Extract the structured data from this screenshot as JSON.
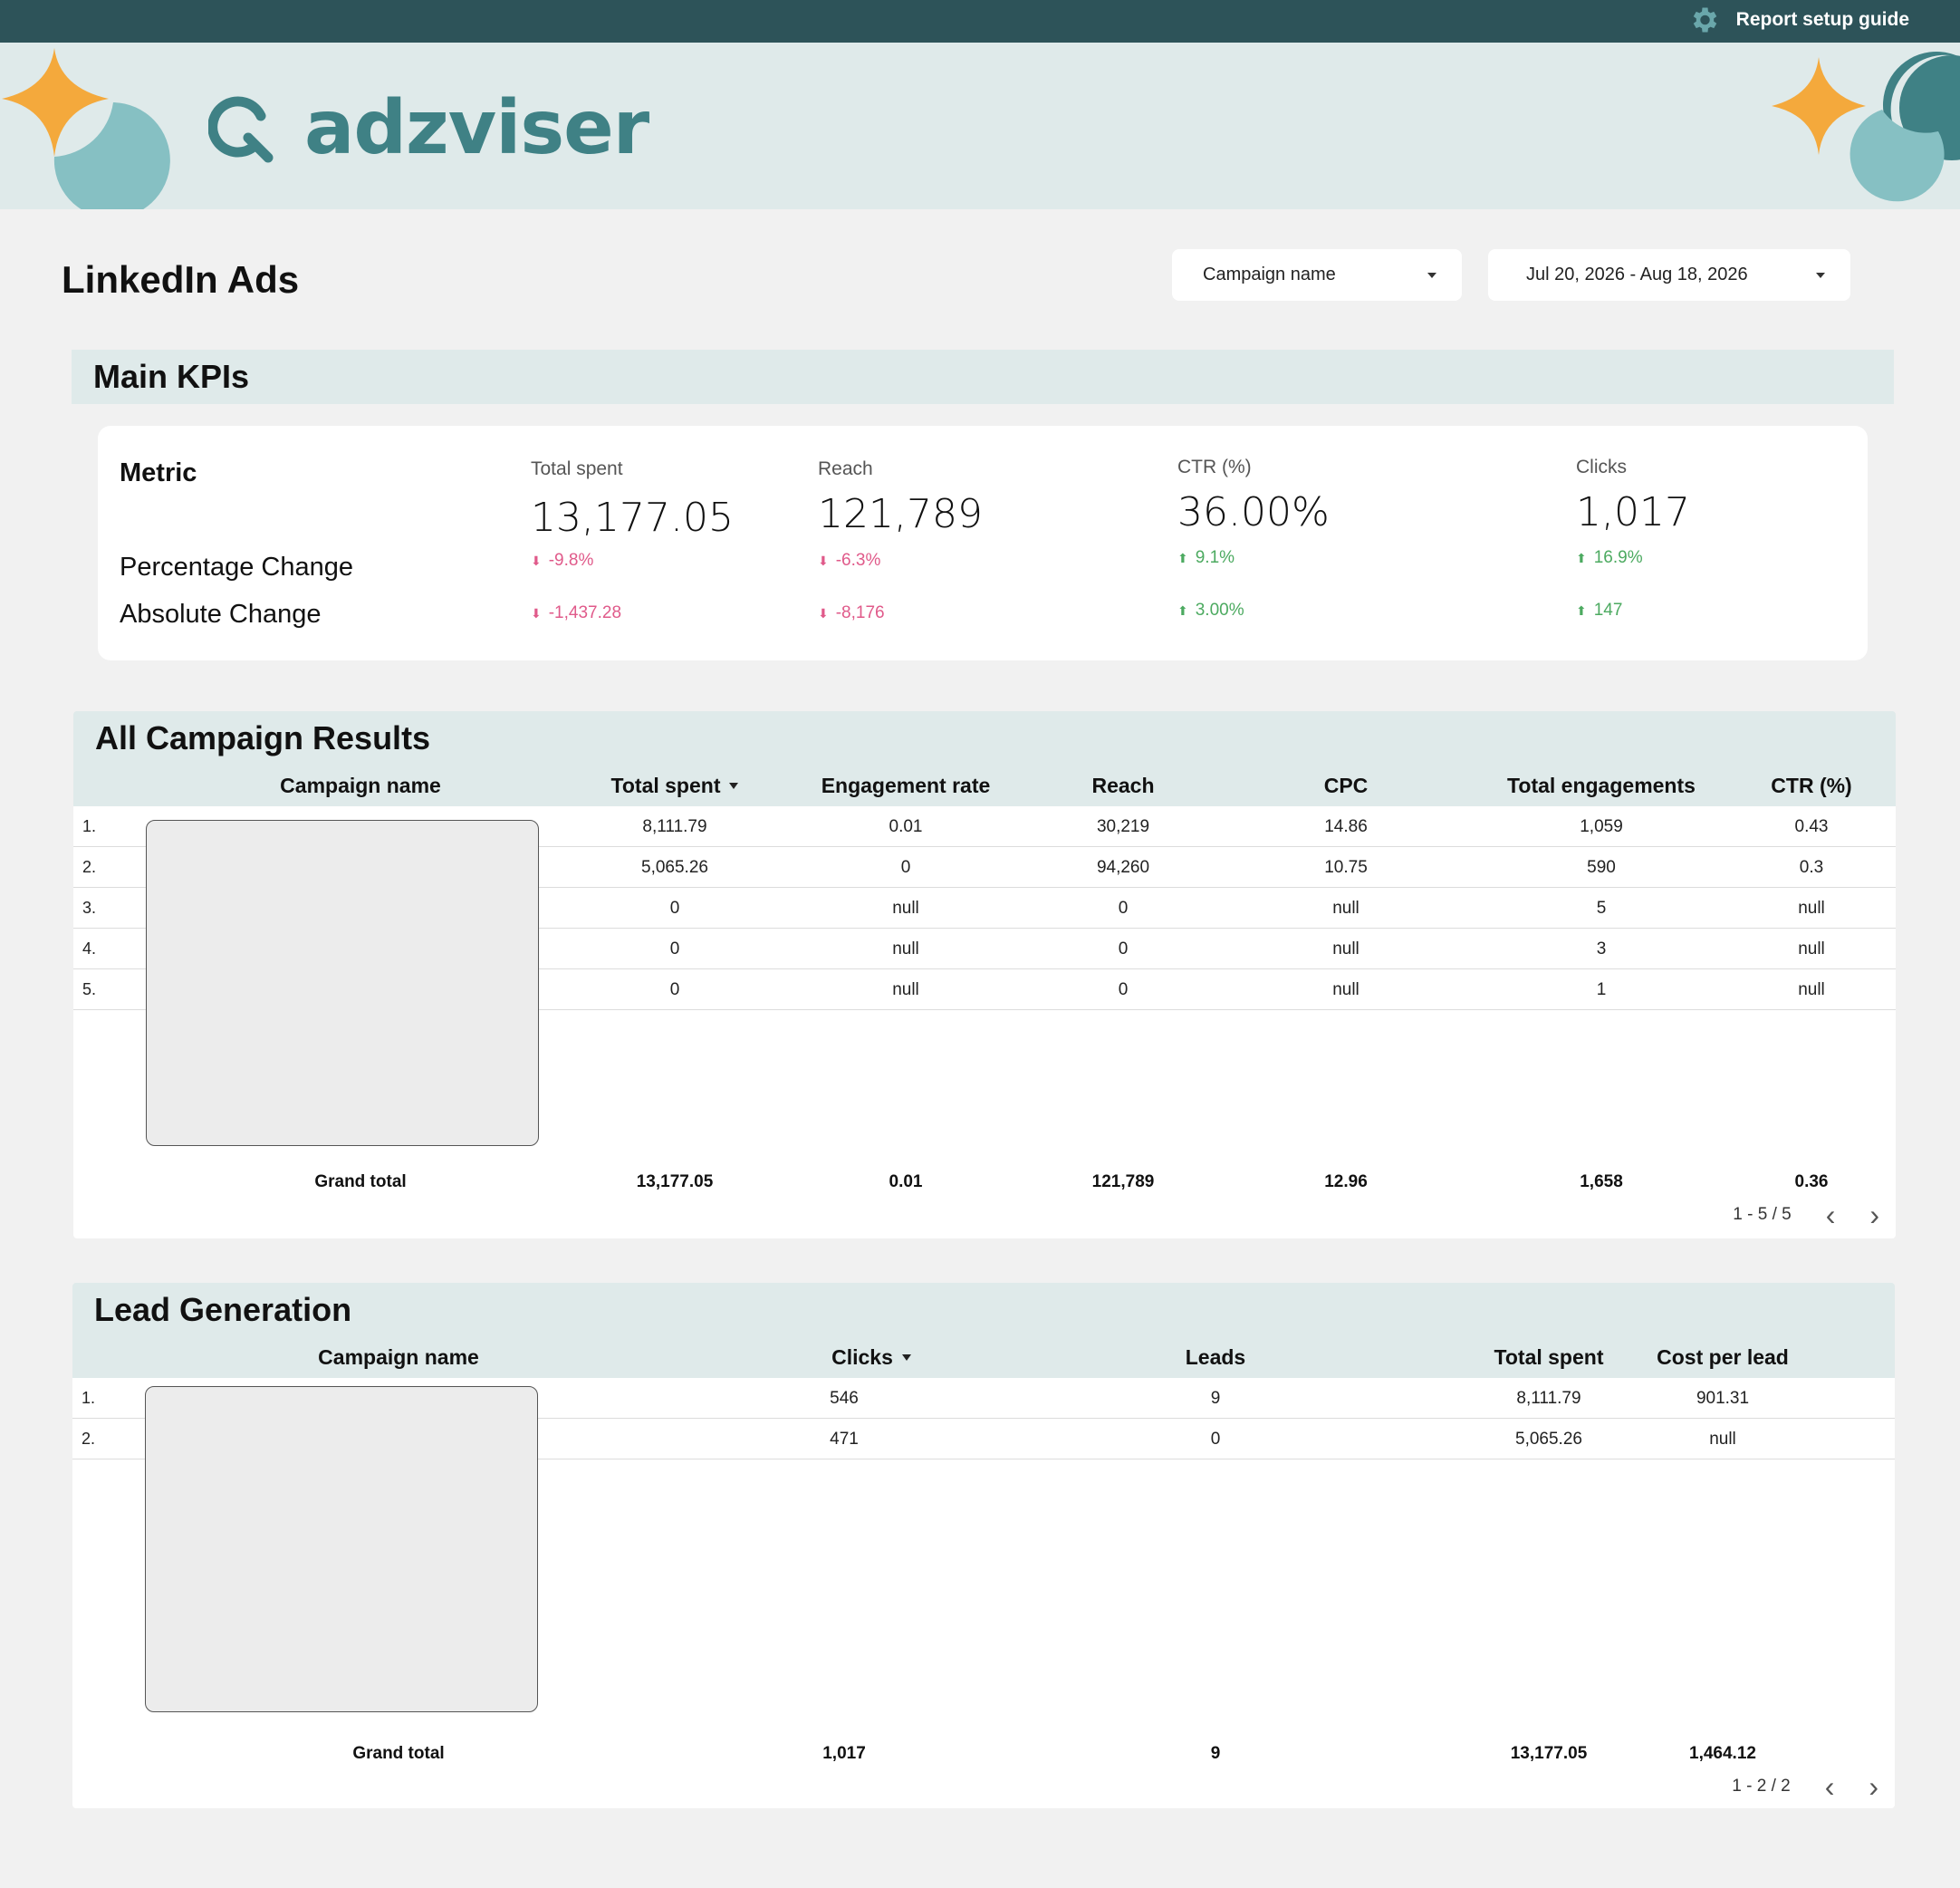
{
  "topbar": {
    "guide_label": "Report setup guide",
    "guide_icon": "gear-icon"
  },
  "brand": {
    "logo_text": "adzviser",
    "colors": {
      "dark": "#2d5359",
      "teal": "#3f8185",
      "light": "#dfeaea",
      "star": "#f4a93c"
    }
  },
  "page": {
    "title": "LinkedIn Ads"
  },
  "filters": {
    "campaign_label": "Campaign name",
    "date_label": "Jul 20, 2026 - Aug 18, 2026"
  },
  "kpi": {
    "section_title": "Main KPIs",
    "metric_label": "Metric",
    "pct_label": "Percentage Change",
    "abs_label": "Absolute Change",
    "metrics": [
      {
        "name": "Total spent",
        "value": "13,177.05",
        "pct": "-9.8%",
        "abs": "-1,437.28",
        "trend": "down"
      },
      {
        "name": "Reach",
        "value": "121,789",
        "pct": "-6.3%",
        "abs": "-8,176",
        "trend": "down"
      },
      {
        "name": "CTR (%)",
        "value": "36.00%",
        "pct": "9.1%",
        "abs": "3.00%",
        "trend": "up"
      },
      {
        "name": "Clicks",
        "value": "1,017",
        "pct": "16.9%",
        "abs": "147",
        "trend": "up"
      }
    ]
  },
  "campaigns": {
    "section_title": "All Campaign Results",
    "columns": [
      "Campaign name",
      "Total spent",
      "Engagement rate",
      "Reach",
      "CPC",
      "Total engagements",
      "CTR (%)"
    ],
    "rows": [
      {
        "idx": "1.",
        "cells": [
          "8,111.79",
          "0.01",
          "30,219",
          "14.86",
          "1,059",
          "0.43"
        ]
      },
      {
        "idx": "2.",
        "cells": [
          "5,065.26",
          "0",
          "94,260",
          "10.75",
          "590",
          "0.3"
        ]
      },
      {
        "idx": "3.",
        "cells": [
          "0",
          "null",
          "0",
          "null",
          "5",
          "null"
        ]
      },
      {
        "idx": "4.",
        "cells": [
          "0",
          "null",
          "0",
          "null",
          "3",
          "null"
        ]
      },
      {
        "idx": "5.",
        "cells": [
          "0",
          "null",
          "0",
          "null",
          "1",
          "null"
        ]
      }
    ],
    "total_label": "Grand total",
    "totals": [
      "13,177.05",
      "0.01",
      "121,789",
      "12.96",
      "1,658",
      "0.36"
    ],
    "pager": "1 - 5 / 5"
  },
  "leads": {
    "section_title": "Lead Generation",
    "columns": [
      "Campaign name",
      "Clicks",
      "Leads",
      "Total spent",
      "Cost per lead"
    ],
    "rows": [
      {
        "idx": "1.",
        "cells": [
          "546",
          "9",
          "8,111.79",
          "901.31"
        ]
      },
      {
        "idx": "2.",
        "cells": [
          "471",
          "0",
          "5,065.26",
          "null"
        ]
      }
    ],
    "total_label": "Grand total",
    "totals": [
      "1,017",
      "9",
      "13,177.05",
      "1,464.12"
    ],
    "pager": "1 - 2 / 2"
  }
}
